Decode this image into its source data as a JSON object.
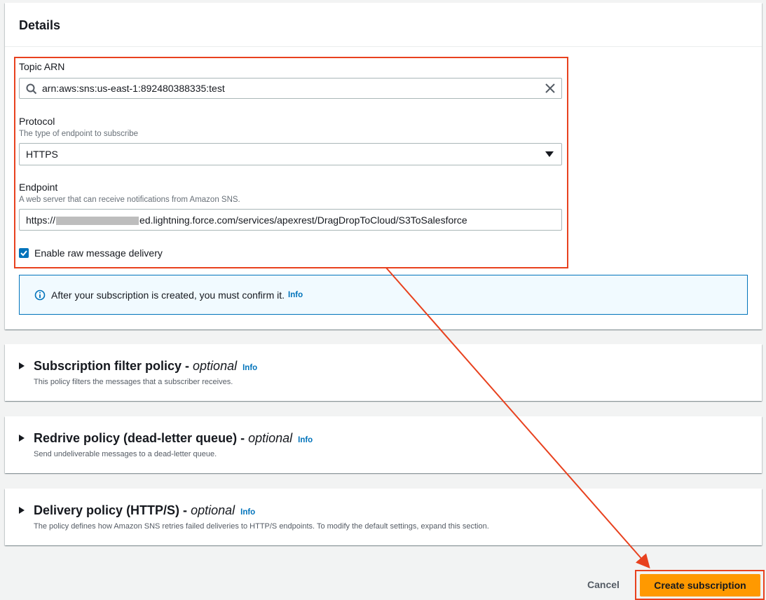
{
  "details": {
    "title": "Details",
    "topic_arn": {
      "label": "Topic ARN",
      "value": "arn:aws:sns:us-east-1:892480388335:test",
      "search_icon": "search-icon",
      "clear_icon": "close-icon"
    },
    "protocol": {
      "label": "Protocol",
      "description": "The type of endpoint to subscribe",
      "selected": "HTTPS",
      "dropdown_icon": "caret-down-icon"
    },
    "endpoint": {
      "label": "Endpoint",
      "description": "A web server that can receive notifications from Amazon SNS.",
      "value_prefix": "https://",
      "value_suffix": "ed.lightning.force.com/services/apexrest/DragDropToCloud/S3ToSalesforce"
    },
    "raw_delivery": {
      "label": "Enable raw message delivery",
      "checked": true
    },
    "alert": {
      "text": "After your subscription is created, you must confirm it.",
      "info": "Info",
      "icon": "info-circle-icon"
    }
  },
  "sections": [
    {
      "title": "Subscription filter policy - ",
      "optional": "optional",
      "info": "Info",
      "description": "This policy filters the messages that a subscriber receives."
    },
    {
      "title": "Redrive policy (dead-letter queue) - ",
      "optional": "optional",
      "info": "Info",
      "description": "Send undeliverable messages to a dead-letter queue."
    },
    {
      "title": "Delivery policy (HTTP/S) - ",
      "optional": "optional",
      "info": "Info",
      "description": "The policy defines how Amazon SNS retries failed deliveries to HTTP/S endpoints. To modify the default settings, expand this section."
    }
  ],
  "footer": {
    "cancel_label": "Cancel",
    "create_label": "Create subscription"
  },
  "colors": {
    "accent": "#0073bb",
    "primary_button": "#ff9900",
    "annotation": "#e8411e"
  }
}
